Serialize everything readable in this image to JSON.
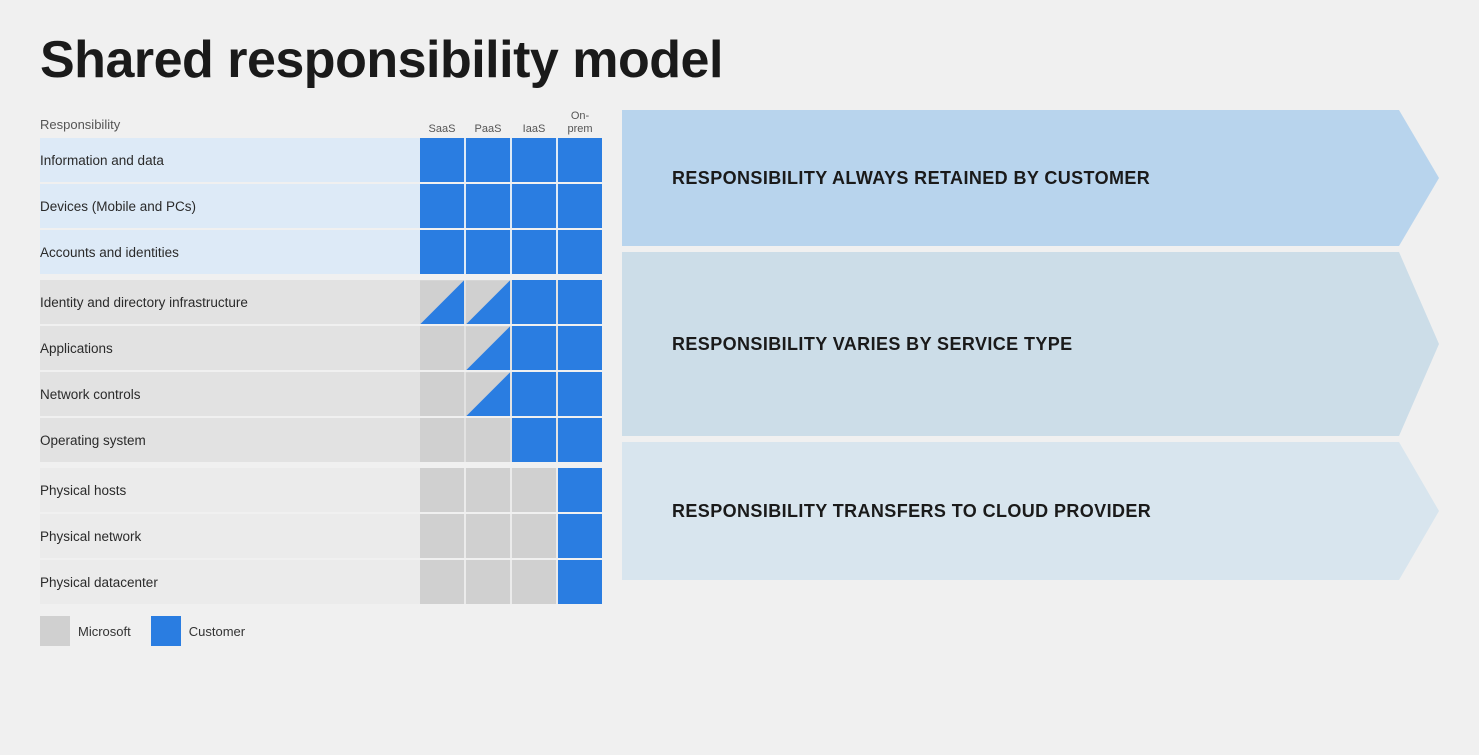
{
  "title": "Shared responsibility model",
  "header": {
    "responsibility_label": "Responsibility",
    "columns": [
      "SaaS",
      "PaaS",
      "IaaS",
      "On-\nprem"
    ]
  },
  "rows": [
    {
      "label": "Information and data",
      "section": 1,
      "cells": [
        "blue",
        "blue",
        "blue",
        "blue"
      ]
    },
    {
      "label": "Devices (Mobile and PCs)",
      "section": 1,
      "cells": [
        "blue",
        "blue",
        "blue",
        "blue"
      ]
    },
    {
      "label": "Accounts and identities",
      "section": 1,
      "cells": [
        "blue",
        "blue",
        "blue",
        "blue"
      ]
    },
    {
      "label": "Identity and directory infrastructure",
      "section": 2,
      "cells": [
        "diag",
        "diag",
        "blue",
        "blue"
      ]
    },
    {
      "label": "Applications",
      "section": 2,
      "cells": [
        "gray",
        "diag",
        "blue",
        "blue"
      ]
    },
    {
      "label": "Network controls",
      "section": 2,
      "cells": [
        "gray",
        "diag",
        "blue",
        "blue"
      ]
    },
    {
      "label": "Operating system",
      "section": 2,
      "cells": [
        "gray",
        "gray",
        "blue",
        "blue"
      ]
    },
    {
      "label": "Physical hosts",
      "section": 3,
      "cells": [
        "gray",
        "gray",
        "gray",
        "blue"
      ]
    },
    {
      "label": "Physical network",
      "section": 3,
      "cells": [
        "gray",
        "gray",
        "gray",
        "blue"
      ]
    },
    {
      "label": "Physical datacenter",
      "section": 3,
      "cells": [
        "gray",
        "gray",
        "gray",
        "blue"
      ]
    }
  ],
  "banners": [
    {
      "text": "RESPONSIBILITY ALWAYS RETAINED BY CUSTOMER",
      "rows": 3
    },
    {
      "text": "RESPONSIBILITY VARIES BY SERVICE TYPE",
      "rows": 4
    },
    {
      "text": "RESPONSIBILITY TRANSFERS TO CLOUD PROVIDER",
      "rows": 3
    }
  ],
  "legend": {
    "items": [
      {
        "label": "Microsoft",
        "color": "#d0d0d0"
      },
      {
        "label": "Customer",
        "color": "#2a7de1"
      }
    ]
  }
}
